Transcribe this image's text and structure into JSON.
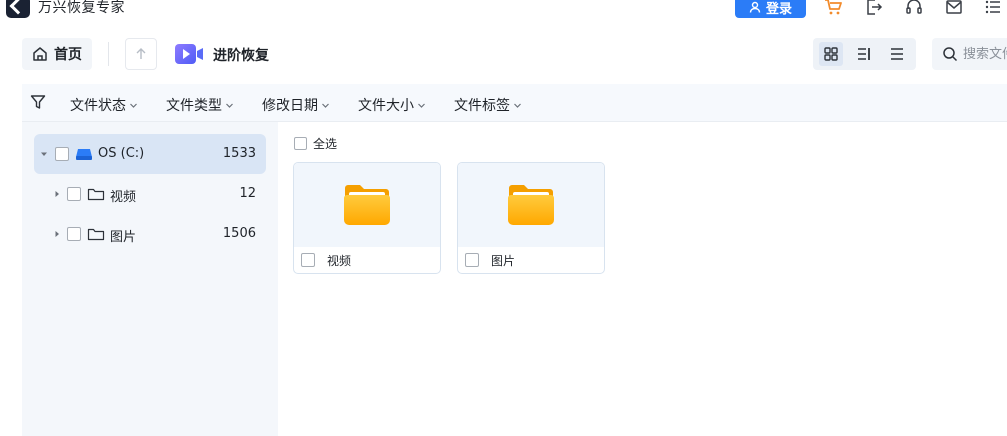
{
  "app": {
    "title": "万兴恢复专家",
    "login_label": "登录"
  },
  "titlebar_icons": [
    "cart-icon",
    "export-icon",
    "headset-icon",
    "mail-icon",
    "menu-icon"
  ],
  "toolbar": {
    "home_label": "首页",
    "breadcrumb_label": "进阶恢复",
    "search_placeholder": "搜索文件"
  },
  "filters": [
    {
      "label": "文件状态"
    },
    {
      "label": "文件类型"
    },
    {
      "label": "修改日期"
    },
    {
      "label": "文件大小"
    },
    {
      "label": "文件标签"
    }
  ],
  "tree": [
    {
      "label": "OS (C:)",
      "count": "1533",
      "icon": "drive-icon",
      "selected": true
    },
    {
      "label": "视频",
      "count": "12",
      "icon": "folder-icon"
    },
    {
      "label": "图片",
      "count": "1506",
      "icon": "folder-icon"
    }
  ],
  "main": {
    "select_all_label": "全选",
    "items": [
      {
        "name": "视频"
      },
      {
        "name": "图片"
      }
    ]
  },
  "colors": {
    "accent": "#2b7cf7",
    "folder": "#ffb300",
    "sidebar_selected": "#d9e5f5"
  }
}
